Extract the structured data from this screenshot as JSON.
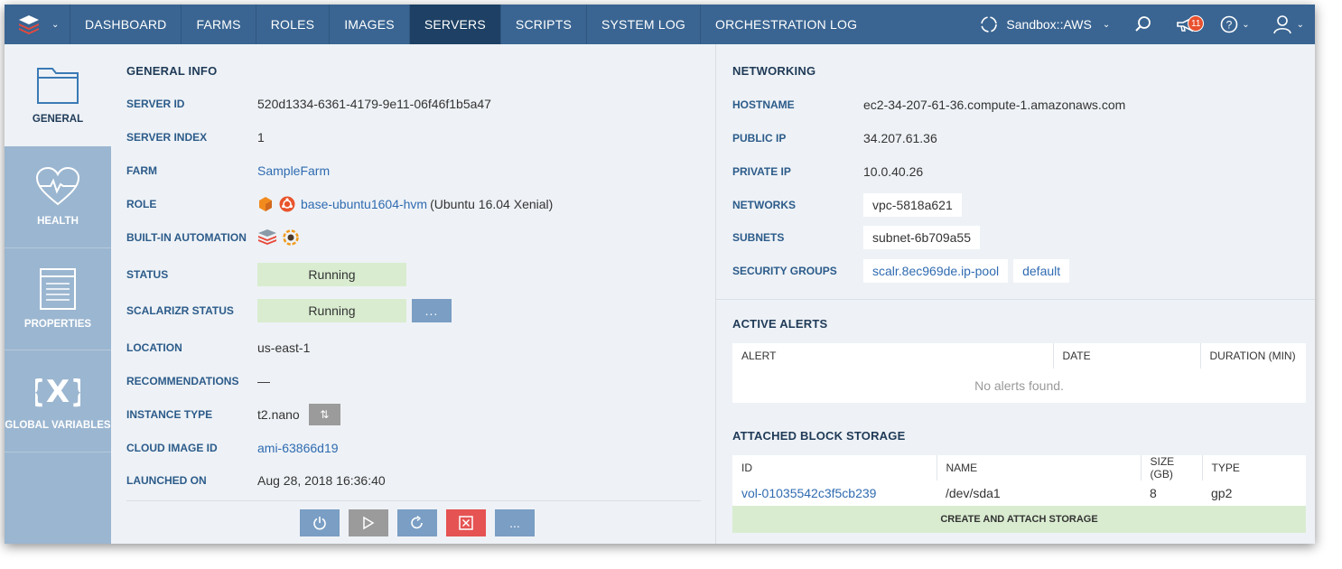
{
  "nav": {
    "items": [
      {
        "label": "DASHBOARD",
        "name": "nav-dashboard"
      },
      {
        "label": "FARMS",
        "name": "nav-farms"
      },
      {
        "label": "ROLES",
        "name": "nav-roles"
      },
      {
        "label": "IMAGES",
        "name": "nav-images"
      },
      {
        "label": "SERVERS",
        "name": "nav-servers"
      },
      {
        "label": "SCRIPTS",
        "name": "nav-scripts"
      },
      {
        "label": "SYSTEM LOG",
        "name": "nav-system-log"
      },
      {
        "label": "ORCHESTRATION LOG",
        "name": "nav-orchestration-log"
      }
    ],
    "active": "SERVERS",
    "environment": "Sandbox::AWS",
    "notification_count": "11",
    "colors": {
      "bar": "#3a6592",
      "active": "#1d4064"
    }
  },
  "sidebar": {
    "items": [
      {
        "label": "GENERAL",
        "icon": "folder-icon"
      },
      {
        "label": "HEALTH",
        "icon": "heart-pulse-icon"
      },
      {
        "label": "PROPERTIES",
        "icon": "document-icon"
      },
      {
        "label": "GLOBAL VARIABLES",
        "icon": "braces-x-icon"
      }
    ]
  },
  "general": {
    "title": "GENERAL INFO",
    "server_id_label": "SERVER ID",
    "server_id": "520d1334-6361-4179-9e11-06f46f1b5a47",
    "server_index_label": "SERVER INDEX",
    "server_index": "1",
    "farm_label": "FARM",
    "farm": "SampleFarm",
    "role_label": "ROLE",
    "role_name": "base-ubuntu1604-hvm",
    "role_os": "(Ubuntu 16.04 Xenial)",
    "automation_label": "BUILT-IN AUTOMATION",
    "status_label": "STATUS",
    "status": "Running",
    "scalarizr_label": "SCALARIZR STATUS",
    "scalarizr_status": "Running",
    "dots": "...",
    "location_label": "LOCATION",
    "location": "us-east-1",
    "recommendations_label": "RECOMMENDATIONS",
    "recommendations": "—",
    "instance_type_label": "INSTANCE TYPE",
    "instance_type": "t2.nano",
    "cloud_image_label": "CLOUD IMAGE ID",
    "cloud_image": "ami-63866d19",
    "launched_label": "LAUNCHED ON",
    "launched": "Aug 28, 2018 16:36:40",
    "status_color": "#d9ecd0"
  },
  "networking": {
    "title": "NETWORKING",
    "hostname_label": "HOSTNAME",
    "hostname": "ec2-34-207-61-36.compute-1.amazonaws.com",
    "public_ip_label": "PUBLIC IP",
    "public_ip": "34.207.61.36",
    "private_ip_label": "PRIVATE IP",
    "private_ip": "10.0.40.26",
    "networks_label": "NETWORKS",
    "network": "vpc-5818a621",
    "subnets_label": "SUBNETS",
    "subnet": "subnet-6b709a55",
    "security_groups_label": "SECURITY GROUPS",
    "security_groups": [
      "scalr.8ec969de.ip-pool",
      "default"
    ]
  },
  "alerts": {
    "title": "ACTIVE ALERTS",
    "columns": [
      "ALERT",
      "DATE",
      "DURATION (MIN)"
    ],
    "empty": "No alerts found."
  },
  "storage": {
    "title": "ATTACHED BLOCK STORAGE",
    "columns": [
      "ID",
      "NAME",
      "SIZE (GB)",
      "TYPE"
    ],
    "rows": [
      {
        "id": "vol-01035542c3f5cb239",
        "name": "/dev/sda1",
        "size": "8",
        "type": "gp2"
      }
    ],
    "create_label": "CREATE AND ATTACH STORAGE"
  }
}
